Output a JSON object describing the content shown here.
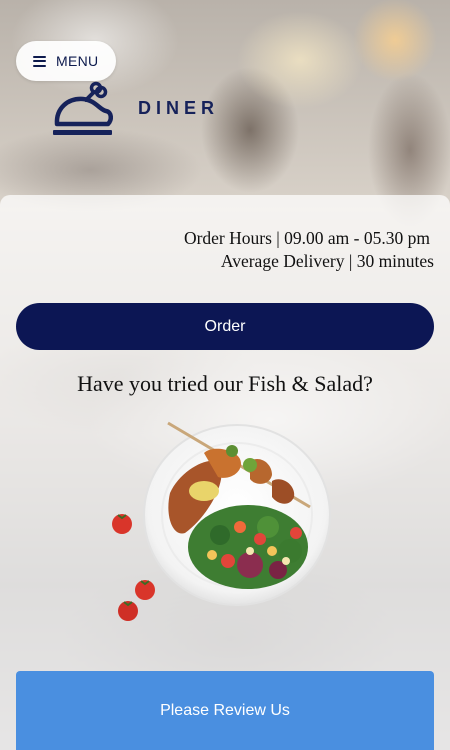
{
  "header": {
    "menu_label": "MENU",
    "menu_icon": "hamburger-icon",
    "logo_icon": "roast-chicken-icon",
    "brand_name": "DINER"
  },
  "info": {
    "order_hours": "Order Hours | 09.00 am - 05.30 pm",
    "average_delivery": "Average Delivery | 30 minutes"
  },
  "actions": {
    "order_label": "Order",
    "review_label": "Please Review Us"
  },
  "promo": {
    "headline": "Have you tried our Fish & Salad?",
    "image": "fish-and-salad-plate"
  },
  "colors": {
    "navy": "#0c1654",
    "brand_text": "#16225a",
    "review_blue": "#4a8fe0"
  }
}
